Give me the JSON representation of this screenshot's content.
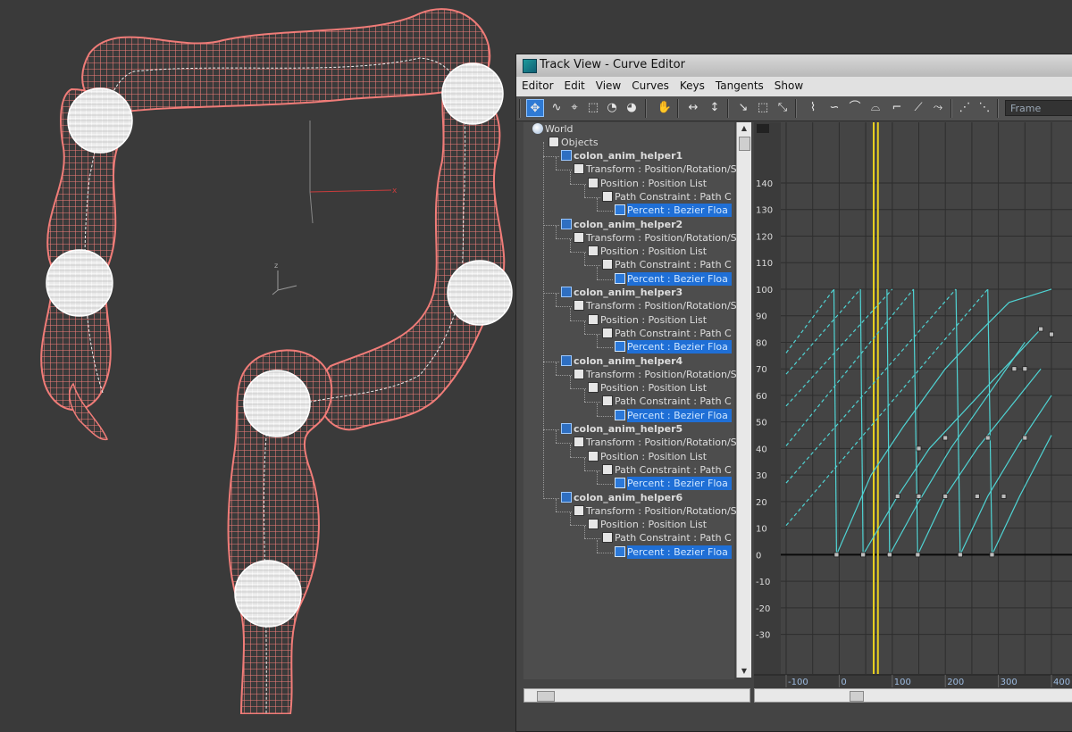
{
  "window": {
    "title": "Track View - Curve Editor",
    "menu": [
      "Editor",
      "Edit",
      "View",
      "Curves",
      "Keys",
      "Tangents",
      "Show"
    ],
    "frame_field": "Frame"
  },
  "viewport": {
    "axis_x_label": "x",
    "axis_z_label": "z",
    "mesh_color": "#f07c78",
    "helper_color": "#ffffff"
  },
  "toolbar_icons": [
    "move-keys-icon",
    "draw-curves-icon",
    "add-keys-icon",
    "region-select-icon",
    "retime-icon",
    "retime-all-icon",
    "soft-select-icon",
    "pan-icon",
    "fit-horizontal-icon",
    "fit-vertical-icon",
    "select-by-value-icon",
    "select-region-icon",
    "isolate-curve-icon",
    "tangent-auto-icon",
    "tangent-custom-icon",
    "tangent-fast-icon",
    "tangent-slow-icon",
    "tangent-step-icon",
    "tangent-linear-icon",
    "tangent-smooth-icon",
    "break-tangents-icon",
    "unify-tangents-icon"
  ],
  "tree": {
    "world": "World",
    "objects": "Objects",
    "helpers": [
      {
        "name": "colon_anim_helper1",
        "transform": "Transform : Position/Rotation/S",
        "position": "Position : Position List",
        "path": "Path Constraint : Path C",
        "percent": "Percent : Bezier Floa"
      },
      {
        "name": "colon_anim_helper2",
        "transform": "Transform : Position/Rotation/S",
        "position": "Position : Position List",
        "path": "Path Constraint : Path C",
        "percent": "Percent : Bezier Floa"
      },
      {
        "name": "colon_anim_helper3",
        "transform": "Transform : Position/Rotation/S",
        "position": "Position : Position List",
        "path": "Path Constraint : Path C",
        "percent": "Percent : Bezier Floa"
      },
      {
        "name": "colon_anim_helper4",
        "transform": "Transform : Position/Rotation/S",
        "position": "Position : Position List",
        "path": "Path Constraint : Path C",
        "percent": "Percent : Bezier Floa"
      },
      {
        "name": "colon_anim_helper5",
        "transform": "Transform : Position/Rotation/S",
        "position": "Position : Position List",
        "path": "Path Constraint : Path C",
        "percent": "Percent : Bezier Floa"
      },
      {
        "name": "colon_anim_helper6",
        "transform": "Transform : Position/Rotation/S",
        "position": "Position : Position List",
        "path": "Path Constraint : Path C",
        "percent": "Percent : Bezier Floa"
      }
    ]
  },
  "graph": {
    "y_ticks": [
      "140",
      "130",
      "120",
      "110",
      "100",
      "90",
      "80",
      "70",
      "60",
      "50",
      "40",
      "30",
      "20",
      "10",
      "0",
      "-10",
      "-20",
      "-30"
    ],
    "x_ticks": [
      "-100",
      "0",
      "100",
      "200",
      "300",
      "400"
    ],
    "curve_color": "#4fd3d3",
    "timeslider_color": "#e8d020",
    "grid_color": "#2d2d2d"
  }
}
